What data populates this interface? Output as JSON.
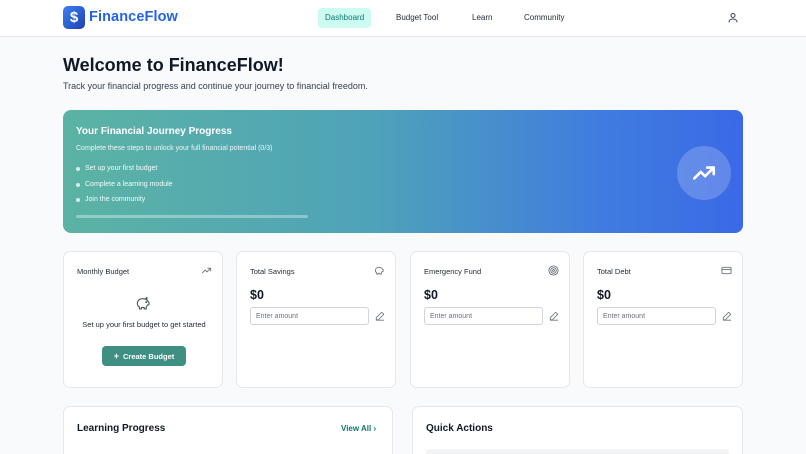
{
  "header": {
    "logo_glyph": "$",
    "brand": "FinanceFlow",
    "nav": [
      {
        "label": "Dashboard",
        "active": true
      },
      {
        "label": "Budget Tool",
        "active": false
      },
      {
        "label": "Learn",
        "active": false
      },
      {
        "label": "Community",
        "active": false
      }
    ],
    "user_icon": "user-icon"
  },
  "hero": {
    "title": "Welcome to FinanceFlow!",
    "subtitle": "Track your financial progress and continue your journey to financial freedom."
  },
  "journey": {
    "title": "Your Financial Journey Progress",
    "description": "Complete these steps to unlock your full financial potential (0/3)",
    "steps": [
      "Set up your first budget",
      "Complete a learning module",
      "Join the community"
    ],
    "progress_fraction": 0,
    "icon": "trending-up-icon"
  },
  "cards": {
    "budget": {
      "label": "Monthly Budget",
      "icon": "trending-up-icon",
      "empty_icon": "piggy-bank-icon",
      "empty_text": "Set up your first budget to get started",
      "button_label": "Create Budget"
    },
    "savings": {
      "label": "Total Savings",
      "icon": "piggy-bank-icon",
      "value": "$0",
      "placeholder": "Enter amount"
    },
    "emergency": {
      "label": "Emergency Fund",
      "icon": "target-icon",
      "value": "$0",
      "placeholder": "Enter amount"
    },
    "debt": {
      "label": "Total Debt",
      "icon": "credit-card-icon",
      "value": "$0",
      "placeholder": "Enter amount"
    }
  },
  "panels": {
    "learning": {
      "title": "Learning Progress",
      "view_all": "View All"
    },
    "quick_actions": {
      "title": "Quick Actions"
    }
  },
  "colors": {
    "brand": "#2563eb",
    "accent_teal": "#0f766e",
    "nav_active_bg": "#ccfbf1",
    "button": "#3f8f83",
    "banner_start": "#5bb3a4",
    "banner_end": "#3b69e6"
  }
}
